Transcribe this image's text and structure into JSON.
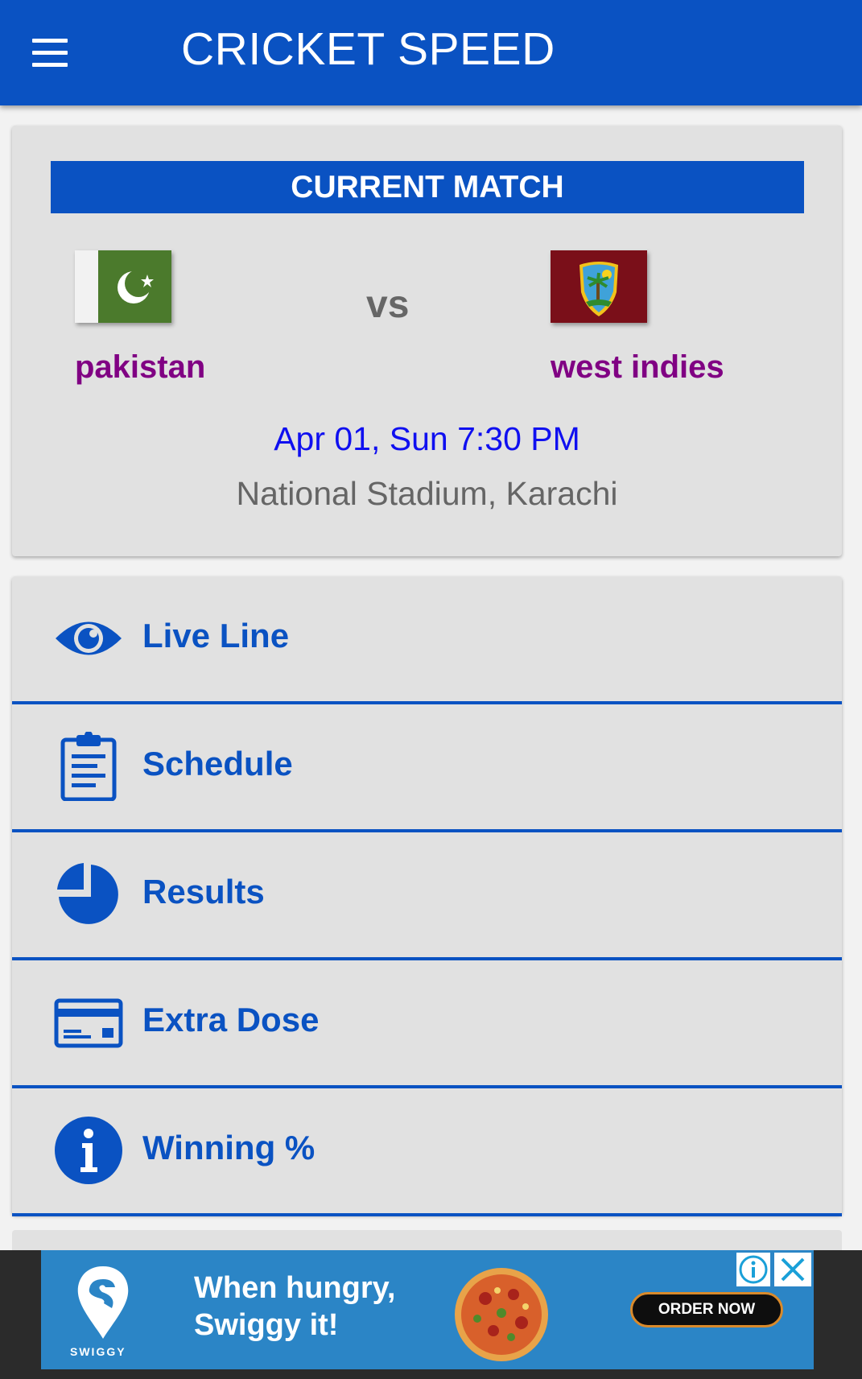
{
  "app": {
    "title": "CRICKET SPEED"
  },
  "current_match": {
    "header": "CURRENT MATCH",
    "team1": {
      "name": "pakistan",
      "flag_icon": "pakistan-flag-icon"
    },
    "vs": "vs",
    "team2": {
      "name": "west indies",
      "flag_icon": "west-indies-flag-icon"
    },
    "datetime": "Apr 01, Sun 7:30 PM",
    "venue": "National Stadium, Karachi"
  },
  "menu": {
    "items": [
      {
        "label": "Live Line",
        "icon": "eye-icon"
      },
      {
        "label": "Schedule",
        "icon": "clipboard-icon"
      },
      {
        "label": "Results",
        "icon": "pie-chart-icon"
      },
      {
        "label": "Extra Dose",
        "icon": "card-icon"
      },
      {
        "label": "Winning %",
        "icon": "info-icon"
      }
    ]
  },
  "ad": {
    "brand": "SWIGGY",
    "headline_line1": "When hungry,",
    "headline_line2": "Swiggy it!",
    "cta": "ORDER NOW"
  },
  "colors": {
    "primary": "#0a52c2",
    "team_name": "#800083",
    "datetime": "#0f0ff0",
    "venue": "#656565",
    "card_bg": "#e1e1e1"
  }
}
